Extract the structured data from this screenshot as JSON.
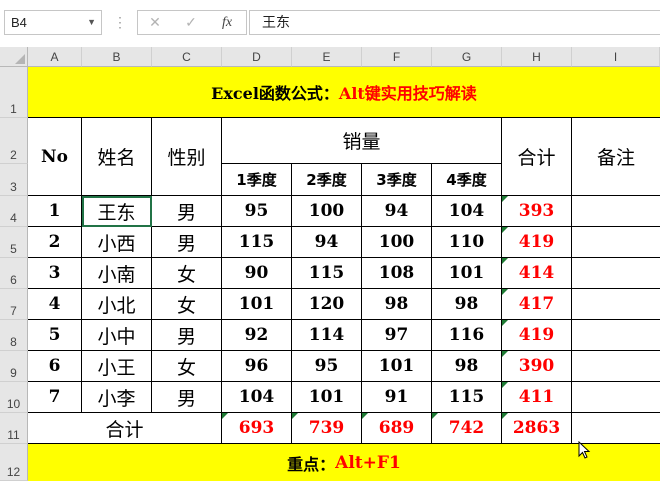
{
  "formula_bar": {
    "name_box": "B4",
    "cancel_icon": "✕",
    "enter_icon": "✓",
    "function_icon": "fx",
    "formula": "王东"
  },
  "columns": [
    "A",
    "B",
    "C",
    "D",
    "E",
    "F",
    "G",
    "H",
    "I"
  ],
  "rows": [
    "1",
    "2",
    "3",
    "4",
    "5",
    "6",
    "7",
    "8",
    "9",
    "10",
    "11",
    "12"
  ],
  "sheet": {
    "title_prefix": "Excel函数公式：",
    "title_highlight": "Alt键实用技巧解读",
    "headers": {
      "no": "No",
      "name": "姓名",
      "gender": "性别",
      "sales": "销量",
      "q1": "1季度",
      "q2": "2季度",
      "q3": "3季度",
      "q4": "4季度",
      "total": "合计",
      "remark": "备注"
    },
    "records": [
      {
        "no": "1",
        "name": "王东",
        "gender": "男",
        "q1": "95",
        "q2": "100",
        "q3": "94",
        "q4": "104",
        "total": "393"
      },
      {
        "no": "2",
        "name": "小西",
        "gender": "男",
        "q1": "115",
        "q2": "94",
        "q3": "100",
        "q4": "110",
        "total": "419"
      },
      {
        "no": "3",
        "name": "小南",
        "gender": "女",
        "q1": "90",
        "q2": "115",
        "q3": "108",
        "q4": "101",
        "total": "414"
      },
      {
        "no": "4",
        "name": "小北",
        "gender": "女",
        "q1": "101",
        "q2": "120",
        "q3": "98",
        "q4": "98",
        "total": "417"
      },
      {
        "no": "5",
        "name": "小中",
        "gender": "男",
        "q1": "92",
        "q2": "114",
        "q3": "97",
        "q4": "116",
        "total": "419"
      },
      {
        "no": "6",
        "name": "小王",
        "gender": "女",
        "q1": "96",
        "q2": "95",
        "q3": "101",
        "q4": "98",
        "total": "390"
      },
      {
        "no": "7",
        "name": "小李",
        "gender": "男",
        "q1": "104",
        "q2": "101",
        "q3": "91",
        "q4": "115",
        "total": "411"
      }
    ],
    "totals": {
      "label": "合计",
      "q1": "693",
      "q2": "739",
      "q3": "689",
      "q4": "742",
      "total": "2863"
    },
    "footer_prefix": "重点：",
    "footer_highlight": "Alt+F1"
  },
  "colors": {
    "title_band": "#ffff00",
    "highlight_text": "#ff0000",
    "error_marker": "#1e7b34"
  }
}
